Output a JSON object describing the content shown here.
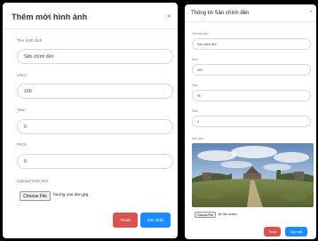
{
  "add_modal": {
    "title": "Thêm mới hình ảnh",
    "close_symbol": "×",
    "fields": [
      {
        "label": "Tên hình ảnh",
        "value": "Sân chính đền"
      },
      {
        "label": "Hfov",
        "value": "100"
      },
      {
        "label": "Yaw",
        "value": "0"
      },
      {
        "label": "Pitch",
        "value": "0"
      }
    ],
    "upload_label": "Upload hình ảnh",
    "choose_file_label": "Choose File",
    "file_name": "huong xao den.jpg",
    "cancel_label": "Thoát",
    "confirm_label": "Xác nhận"
  },
  "info_modal": {
    "title": "Thông tin Sân chính đền",
    "close_symbol": "×",
    "fields": [
      {
        "label": "Tên hình ảnh",
        "value": "Sân chính đền"
      },
      {
        "label": "Hfov",
        "value": "150"
      },
      {
        "label": "Yaw",
        "value": "95"
      },
      {
        "label": "Pitch",
        "value": "0"
      }
    ],
    "image_label": "Hình ảnh",
    "choose_file_label": "Choose File",
    "file_status": "No file chosen",
    "cancel_label": "Thoát",
    "update_label": "Cập nhật"
  },
  "colors": {
    "backdrop": "#000000",
    "cancel": "#d9534f",
    "primary": "#1a8cff"
  }
}
